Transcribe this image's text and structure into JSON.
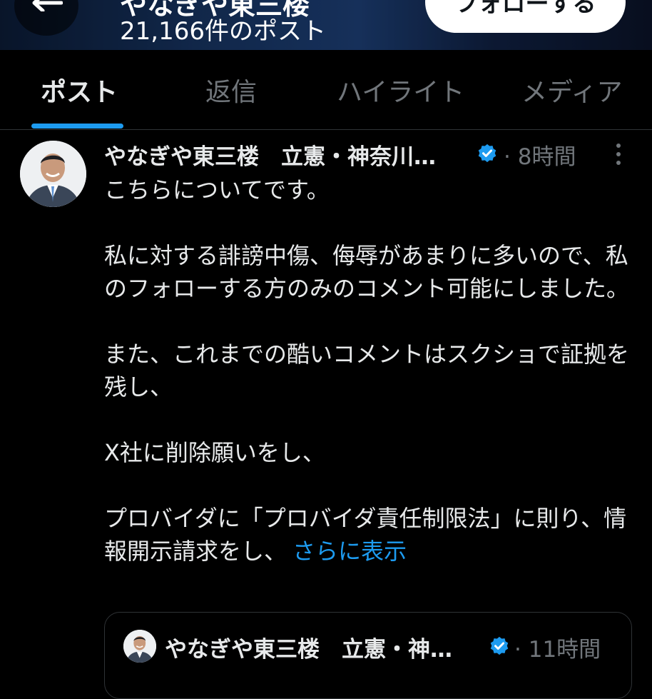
{
  "header": {
    "title": "やなぎや東三楼",
    "post_count": "21,166件のポスト",
    "follow_label": "フォローする"
  },
  "tabs": [
    {
      "label": "ポスト",
      "active": true
    },
    {
      "label": "返信",
      "active": false
    },
    {
      "label": "ハイライト",
      "active": false
    },
    {
      "label": "メディア",
      "active": false
    }
  ],
  "post": {
    "author_name": "やなぎや東三楼　立憲・神奈川…",
    "separator": "·",
    "time": "8時間",
    "body": [
      "こちらについてです。",
      "",
      "私に対する誹謗中傷、侮辱があまりに多いので、私のフォローする方のみのコメント可能にしました。",
      "",
      "また、これまでの酷いコメントはスクショで証拠を残し、",
      "",
      "X社に削除願いをし、",
      "",
      "プロバイダに「プロバイダ責任制限法」に則り、情報開示請求をし、"
    ],
    "show_more": "さらに表示"
  },
  "quote": {
    "author_name": "やなぎや東三楼　立憲・神…",
    "separator": "·",
    "time": "11時間"
  },
  "icons": {
    "back": "arrow-left-icon",
    "verified": "verified-badge-icon",
    "more": "more-vertical-icon"
  },
  "colors": {
    "background": "#000000",
    "accent": "#1d9bf0",
    "text_primary": "#e7e9ea",
    "text_secondary": "#71767b",
    "border": "#2f3336"
  }
}
